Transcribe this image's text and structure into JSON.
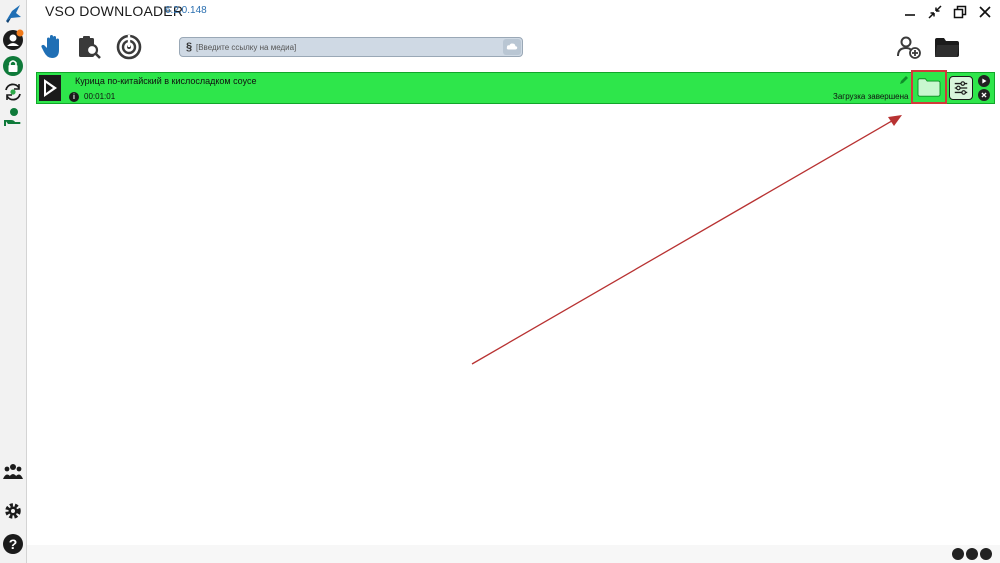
{
  "app": {
    "title": "VSO DOWNLOADER",
    "version": "6.2.0.148"
  },
  "colors": {
    "item_bg": "#2ee64b",
    "item_border": "#12a52a",
    "highlight": "#d23a3a",
    "accent": "#1f6fb5"
  },
  "sidebar": {
    "items": [
      {
        "name": "app-logo",
        "icon": "bird-icon"
      },
      {
        "name": "profile",
        "icon": "user-badge-icon"
      },
      {
        "name": "lock",
        "icon": "lock-icon"
      },
      {
        "name": "convert",
        "icon": "convert-icon"
      },
      {
        "name": "hand-money",
        "icon": "hand-coin-icon"
      },
      {
        "name": "community",
        "icon": "people-icon"
      },
      {
        "name": "settings",
        "icon": "gear-icon"
      },
      {
        "name": "help",
        "icon": "question-icon"
      }
    ]
  },
  "toolbar": {
    "tools": [
      {
        "name": "hand",
        "icon": "hand-icon"
      },
      {
        "name": "clipboard-search",
        "icon": "clipboard-search-icon"
      },
      {
        "name": "radar",
        "icon": "radar-icon"
      }
    ],
    "url_placeholder": "[Введите ссылку на медиа]",
    "right_tools": [
      {
        "name": "add-user",
        "icon": "add-user-icon"
      },
      {
        "name": "open-folder",
        "icon": "folder-icon"
      }
    ]
  },
  "download": {
    "title": "Курица по-китайский в кисло­сладком соусе",
    "duration": "00:01:01",
    "status": "Загрузка завершена"
  }
}
